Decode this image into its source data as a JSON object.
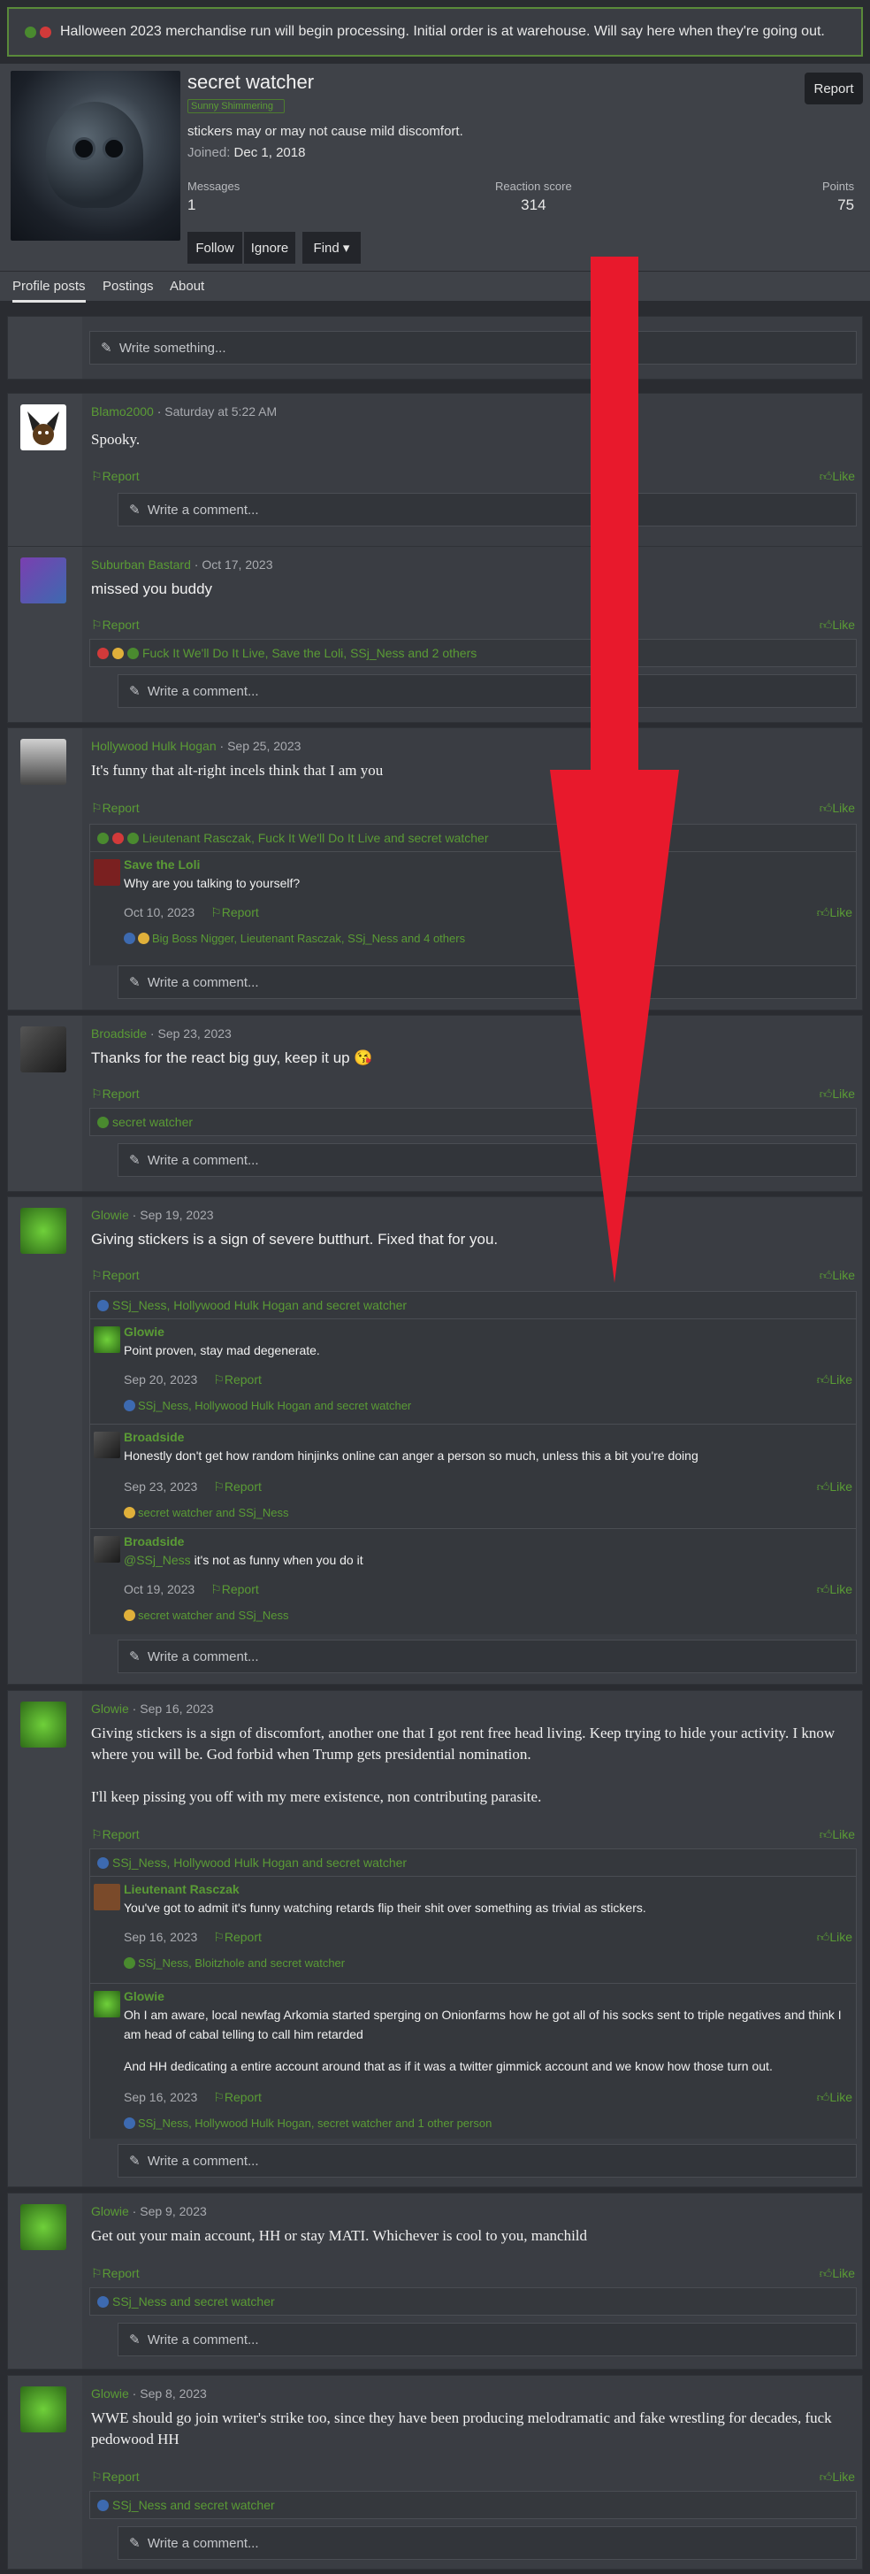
{
  "notice": {
    "text": "Halloween 2023 merchandise run will begin processing. Initial order is at warehouse. Will say here when they're going out."
  },
  "profile": {
    "username": "secret watcher",
    "user_title": "Sunny Shimmering",
    "bio": "stickers may or may not cause mild discomfort.",
    "joined_label": "Joined:",
    "joined_date": "Dec 1, 2018",
    "report": "Report",
    "messages_label": "Messages",
    "messages_value": "1",
    "reaction_label": "Reaction score",
    "reaction_value": "314",
    "points_label": "Points",
    "points_value": "75",
    "follow": "Follow",
    "ignore": "Ignore",
    "find": "Find ▾"
  },
  "tabs": [
    "Profile posts",
    "Postings",
    "About"
  ],
  "write_something": "Write something...",
  "labels": {
    "report": "Report",
    "like": "Like",
    "write_comment": "Write a comment..."
  },
  "posts": [
    {
      "author": "Blamo2000",
      "date": "Saturday at 5:22 AM",
      "text": "Spooky."
    },
    {
      "author": "Suburban Bastard",
      "date": "Oct 17, 2023",
      "text": "missed you buddy",
      "reactions": "Fuck It We'll Do It Live, Save the Loli, SSj_Ness and 2 others"
    },
    {
      "author": "Hollywood Hulk Hogan",
      "date": "Sep 25, 2023",
      "text": "It's funny that alt-right incels think that I am you",
      "reactions": "Lieutenant Rasczak, Fuck It We'll Do It Live and secret watcher",
      "replies": [
        {
          "author": "Save the Loli",
          "text": "Why are you talking to yourself?",
          "date": "Oct 10, 2023",
          "reactions": "Big Boss Nigger, Lieutenant Rasczak, SSj_Ness and 4 others"
        }
      ]
    },
    {
      "author": "Broadside",
      "date": "Sep 23, 2023",
      "text": "Thanks for the react big guy, keep it up 😘",
      "reactions": "secret watcher"
    },
    {
      "author": "Glowie",
      "date": "Sep 19, 2023",
      "text": "Giving stickers is a sign of severe butthurt. Fixed that for you.",
      "reactions": "SSj_Ness, Hollywood Hulk Hogan and secret watcher",
      "replies": [
        {
          "author": "Glowie",
          "text": "Point proven, stay mad degenerate.",
          "date": "Sep 20, 2023",
          "reactions": "SSj_Ness, Hollywood Hulk Hogan and secret watcher"
        },
        {
          "author": "Broadside",
          "text": "Honestly don't get how random hinjinks online can anger a person so much, unless this a bit you're doing",
          "date": "Sep 23, 2023",
          "reactions": "secret watcher and SSj_Ness"
        },
        {
          "author": "Broadside",
          "mention": "@SSj_Ness",
          "text": " it's not as funny when you do it",
          "date": "Oct 19, 2023",
          "reactions": "secret watcher and SSj_Ness"
        }
      ]
    },
    {
      "author": "Glowie",
      "date": "Sep 16, 2023",
      "text": "Giving stickers is a sign of discomfort, another one that I got rent free head living. Keep trying to hide your activity. I know where you will be. God forbid when Trump gets presidential nomination.",
      "text2": "I'll keep pissing you off with my mere existence, non contributing parasite.",
      "reactions": "SSj_Ness, Hollywood Hulk Hogan and secret watcher",
      "replies": [
        {
          "author": "Lieutenant Rasczak",
          "text": "You've got to admit it's funny watching retards flip their shit over something as trivial as stickers.",
          "date": "Sep 16, 2023",
          "reactions": "SSj_Ness, Bloitzhole and secret watcher"
        },
        {
          "author": "Glowie",
          "text": "Oh I am aware, local newfag Arkomia started sperging on Onionfarms how he got all of his socks sent to triple negatives and think I am head of cabal telling to call him retarded",
          "text2": "And HH dedicating a entire account around that as if it was a twitter gimmick account and we know how those turn out.",
          "date": "Sep 16, 2023",
          "reactions": "SSj_Ness, Hollywood Hulk Hogan, secret watcher and 1 other person"
        }
      ]
    },
    {
      "author": "Glowie",
      "date": "Sep 9, 2023",
      "text": "Get out your main account, HH or stay MATI. Whichever is cool to you, manchild",
      "reactions": "SSj_Ness and secret watcher"
    },
    {
      "author": "Glowie",
      "date": "Sep 8, 2023",
      "text": "WWE should go join writer's strike too, since they have been producing melodramatic and fake wrestling for decades, fuck pedowood HH",
      "reactions": "SSj_Ness and secret watcher"
    }
  ],
  "colors": {
    "accent": "#5a9b35",
    "arrow": "#e8192c",
    "bg": "#2a2c31",
    "panel": "#3a3d43"
  }
}
